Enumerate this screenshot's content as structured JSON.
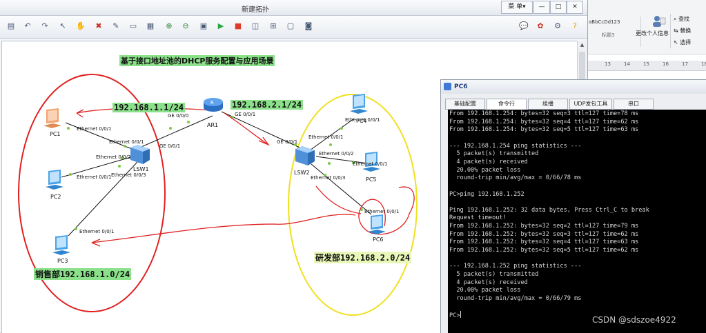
{
  "word": {
    "style_sample": "aBbCcDd123",
    "style_title": "标题3",
    "change_person": "更改个人信息",
    "find": "查找",
    "replace": "替换",
    "select": "选择",
    "ruler_nums": [
      "13",
      "14",
      "15",
      "16",
      "17",
      "18"
    ]
  },
  "ensp": {
    "title": "新建拓扑",
    "menu_label": "菜 单",
    "minimize": "—",
    "restore": "□",
    "close": "✕"
  },
  "topology": {
    "title": "基于接口地址池的DHCP服务配置与应用场景",
    "ip_left": "192.168.1.1/24",
    "ip_right": "192.168.2.1/24",
    "group_left": "销售部192.168.1.0/24",
    "group_right": "研发部192.168.2.0/24",
    "devices": {
      "ar1": "AR1",
      "lsw1": "LSW1",
      "lsw2": "LSW2",
      "pc1": "PC1",
      "pc2": "PC2",
      "pc3": "PC3",
      "pc4": "PC4",
      "pc5": "PC5",
      "pc6": "PC6"
    },
    "ports": {
      "ar1_ge00": "GE 0/0/0",
      "ar1_ge01": "GE 0/0/1",
      "lsw1_ge01": "GE 0/0/1",
      "lsw1_e1": "Ethernet 0/0/1",
      "lsw1_e2": "Ethernet 0/0/2",
      "lsw1_e3": "Ethernet 0/0/3",
      "pc1_e": "Ethernet 0/0/1",
      "pc2_e": "Ethernet 0/0/1",
      "pc3_e": "Ethernet 0/0/1",
      "lsw2_ge01": "GE 0/0/1",
      "lsw2_e1": "Ethernet 0/0/1",
      "lsw2_e2": "Ethernet 0/0/2",
      "lsw2_e3": "Ethernet 0/0/3",
      "pc4_e": "Ethernet 0/0/1",
      "pc5_e": "Ethernet 0/0/1",
      "pc6_e": "Ethernet 0/0/1"
    }
  },
  "pc6": {
    "title": "PC6",
    "tabs": [
      "基础配置",
      "命令行",
      "组播",
      "UDP发包工具",
      "串口"
    ],
    "active_tab": "命令行",
    "lines": [
      "From 192.168.1.254: bytes=32 seq=3 ttl=127 time=78 ms",
      "From 192.168.1.254: bytes=32 seq=4 ttl=127 time=62 ms",
      "From 192.168.1.254: bytes=32 seq=5 ttl=127 time=63 ms",
      "",
      "--- 192.168.1.254 ping statistics ---",
      "  5 packet(s) transmitted",
      "  4 packet(s) received",
      "  20.00% packet loss",
      "  round-trip min/avg/max = 0/66/78 ms",
      "",
      "PC>ping 192.168.1.252",
      "",
      "Ping 192.168.1.252: 32 data bytes, Press Ctrl_C to break",
      "Request timeout!",
      "From 192.168.1.252: bytes=32 seq=2 ttl=127 time=79 ms",
      "From 192.168.1.252: bytes=32 seq=3 ttl=127 time=62 ms",
      "From 192.168.1.252: bytes=32 seq=4 ttl=127 time=63 ms",
      "From 192.168.1.252: bytes=32 seq=5 ttl=127 time=62 ms",
      "",
      "--- 192.168.1.252 ping statistics ---",
      "  5 packet(s) transmitted",
      "  4 packet(s) received",
      "  20.00% packet loss",
      "  round-trip min/avg/max = 0/66/79 ms",
      "",
      "PC>"
    ]
  },
  "watermark": "CSDN @sdszoe4922",
  "colors": {
    "link_label_bg": "#8be08a",
    "left_group_ring": "#e02020",
    "right_group_ring": "#f0e020",
    "annotation": "#e02020",
    "terminal_bg": "#000000"
  }
}
